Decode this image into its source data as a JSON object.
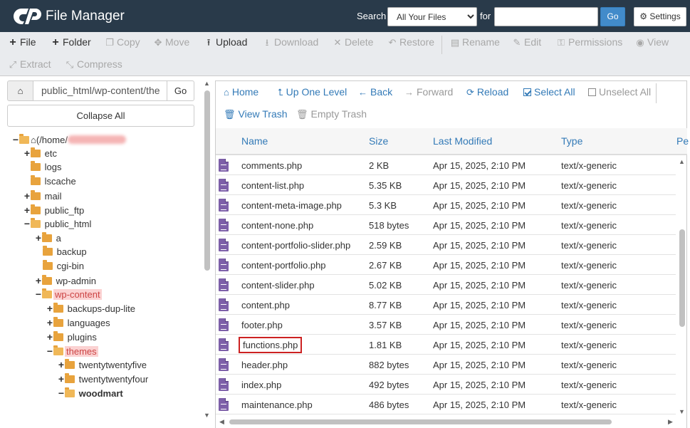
{
  "header": {
    "title": "File Manager",
    "search_label": "Search",
    "search_scope": "All Your Files",
    "for_label": "for",
    "search_value": "",
    "go_label": "Go",
    "settings_label": "Settings",
    "bg_color": "#293a4a"
  },
  "toolbar": {
    "file": "File",
    "folder": "Folder",
    "copy": "Copy",
    "move": "Move",
    "upload": "Upload",
    "download": "Download",
    "delete": "Delete",
    "restore": "Restore",
    "rename": "Rename",
    "edit": "Edit",
    "permissions": "Permissions",
    "view": "View",
    "extract": "Extract",
    "compress": "Compress"
  },
  "left_pane": {
    "path_value": "public_html/wp-content/the",
    "go_label": "Go",
    "collapse_label": "Collapse All",
    "tree": {
      "root": "(/home/",
      "etc": "etc",
      "logs": "logs",
      "lscache": "lscache",
      "mail": "mail",
      "public_ftp": "public_ftp",
      "public_html": "public_html",
      "a": "a",
      "backup": "backup",
      "cgi_bin": "cgi-bin",
      "wp_admin": "wp-admin",
      "wp_content": "wp-content",
      "backups_dup_lite": "backups-dup-lite",
      "languages": "languages",
      "plugins": "plugins",
      "themes": "themes",
      "twentytwentyfive": "twentytwentyfive",
      "twentytwentyfour": "twentytwentyfour",
      "woodmart": "woodmart"
    }
  },
  "right_pane": {
    "nav": {
      "home": "Home",
      "up_one_level": "Up One Level",
      "back": "Back",
      "forward": "Forward",
      "reload": "Reload",
      "select_all": "Select All",
      "unselect_all": "Unselect All",
      "view_trash": "View Trash",
      "empty_trash": "Empty Trash"
    },
    "columns": {
      "name": "Name",
      "size": "Size",
      "last_modified": "Last Modified",
      "type": "Type",
      "perms": "Pe"
    },
    "files": [
      {
        "name": "comments.php",
        "size": "2 KB",
        "modified": "Apr 15, 2025, 2:10 PM",
        "type": "text/x-generic"
      },
      {
        "name": "content-list.php",
        "size": "5.35 KB",
        "modified": "Apr 15, 2025, 2:10 PM",
        "type": "text/x-generic"
      },
      {
        "name": "content-meta-image.php",
        "size": "5.3 KB",
        "modified": "Apr 15, 2025, 2:10 PM",
        "type": "text/x-generic"
      },
      {
        "name": "content-none.php",
        "size": "518 bytes",
        "modified": "Apr 15, 2025, 2:10 PM",
        "type": "text/x-generic"
      },
      {
        "name": "content-portfolio-slider.php",
        "size": "2.59 KB",
        "modified": "Apr 15, 2025, 2:10 PM",
        "type": "text/x-generic"
      },
      {
        "name": "content-portfolio.php",
        "size": "2.67 KB",
        "modified": "Apr 15, 2025, 2:10 PM",
        "type": "text/x-generic"
      },
      {
        "name": "content-slider.php",
        "size": "5.02 KB",
        "modified": "Apr 15, 2025, 2:10 PM",
        "type": "text/x-generic"
      },
      {
        "name": "content.php",
        "size": "8.77 KB",
        "modified": "Apr 15, 2025, 2:10 PM",
        "type": "text/x-generic"
      },
      {
        "name": "footer.php",
        "size": "3.57 KB",
        "modified": "Apr 15, 2025, 2:10 PM",
        "type": "text/x-generic"
      },
      {
        "name": "functions.php",
        "size": "1.81 KB",
        "modified": "Apr 15, 2025, 2:10 PM",
        "type": "text/x-generic",
        "highlighted": true
      },
      {
        "name": "header.php",
        "size": "882 bytes",
        "modified": "Apr 15, 2025, 2:10 PM",
        "type": "text/x-generic"
      },
      {
        "name": "index.php",
        "size": "492 bytes",
        "modified": "Apr 15, 2025, 2:10 PM",
        "type": "text/x-generic"
      },
      {
        "name": "maintenance.php",
        "size": "486 bytes",
        "modified": "Apr 15, 2025, 2:10 PM",
        "type": "text/x-generic"
      }
    ]
  }
}
